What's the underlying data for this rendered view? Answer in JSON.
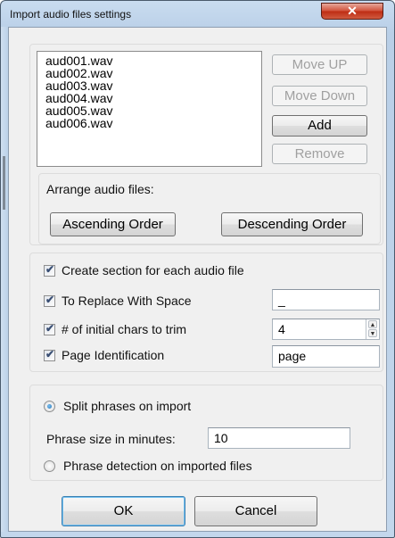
{
  "window": {
    "title": "Import audio files settings",
    "close_glyph": "✕"
  },
  "file_list": {
    "items": [
      "aud001.wav",
      "aud002.wav",
      "aud003.wav",
      "aud004.wav",
      "aud005.wav",
      "aud006.wav"
    ],
    "buttons": {
      "move_up": "Move UP",
      "move_down": "Move Down",
      "add": "Add",
      "remove": "Remove"
    }
  },
  "arrange": {
    "label": "Arrange audio files:",
    "ascending": "Ascending Order",
    "descending": "Descending Order"
  },
  "options": {
    "create_section": {
      "label": "Create section for each audio file",
      "checked": true
    },
    "replace_space": {
      "label": "To Replace With Space",
      "checked": true,
      "value": "_"
    },
    "trim_chars": {
      "label": "# of initial chars to trim",
      "checked": true,
      "value": "4"
    },
    "page_id": {
      "label": "Page Identification",
      "checked": true,
      "value": "page"
    }
  },
  "phrases": {
    "split": {
      "label": "Split phrases on import",
      "selected": true
    },
    "size_label": "Phrase size in minutes:",
    "size_value": "10",
    "detect": {
      "label": "Phrase detection on imported files",
      "selected": false
    }
  },
  "footer": {
    "ok": "OK",
    "cancel": "Cancel"
  },
  "icons": {
    "check": "✔",
    "spin_up": "▲",
    "spin_down": "▼"
  }
}
